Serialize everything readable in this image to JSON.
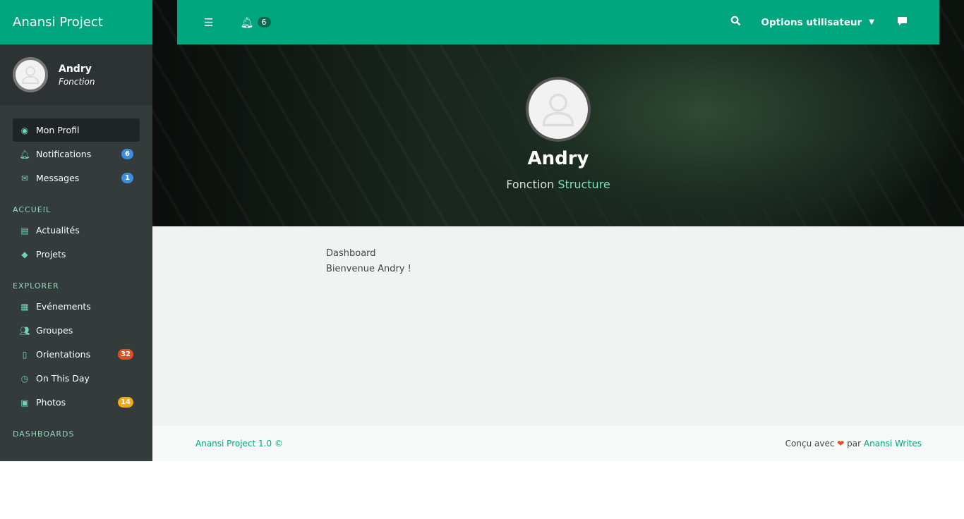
{
  "app": {
    "title": "Anansi Project"
  },
  "user": {
    "name": "Andry",
    "function": "Fonction"
  },
  "sidebar": {
    "top": [
      {
        "label": "Mon Profil",
        "icon": "user-circle-icon",
        "active": true
      },
      {
        "label": "Notifications",
        "icon": "bell-icon",
        "badge": "6",
        "badge_color": "#3a8de0"
      },
      {
        "label": "Messages",
        "icon": "envelope-open-icon",
        "badge": "1",
        "badge_color": "#3a8de0"
      }
    ],
    "sections": [
      {
        "title": "ACCUEIL",
        "items": [
          {
            "label": "Actualités",
            "icon": "newspaper-icon"
          },
          {
            "label": "Projets",
            "icon": "gem-icon"
          }
        ]
      },
      {
        "title": "EXPLORER",
        "items": [
          {
            "label": "Evénements",
            "icon": "calendar-icon"
          },
          {
            "label": "Groupes",
            "icon": "users-icon"
          },
          {
            "label": "Orientations",
            "icon": "file-icon",
            "badge": "32",
            "badge_color": "#e0501e"
          },
          {
            "label": "On This Day",
            "icon": "clock-icon"
          },
          {
            "label": "Photos",
            "icon": "images-icon",
            "badge": "14",
            "badge_color": "#f5a80f"
          }
        ]
      },
      {
        "title": "DASHBOARDS",
        "items": []
      }
    ]
  },
  "topbar": {
    "notif_count": "6",
    "user_options": "Options utilisateur"
  },
  "hero": {
    "name": "Andry",
    "function": "Fonction",
    "structure": "Structure"
  },
  "main": {
    "breadcrumb": "Dashboard",
    "welcome": "Bienvenue Andry !"
  },
  "footer": {
    "left": "Anansi Project 1.0 ©",
    "made_with": "Conçu avec",
    "heart": "❤",
    "by": "par",
    "author": "Anansi Writes",
    "heart_color": "#e0501e"
  }
}
